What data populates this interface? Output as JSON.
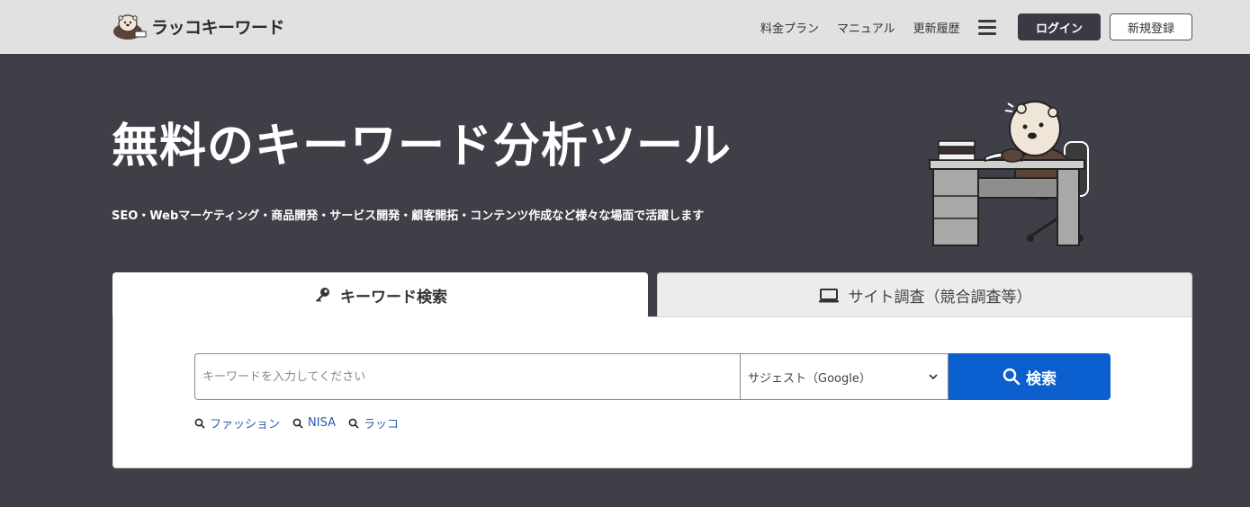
{
  "header": {
    "logo_text": "ラッコキーワード",
    "nav": [
      "料金プラン",
      "マニュアル",
      "更新履歴"
    ],
    "login": "ログイン",
    "signup": "新規登録"
  },
  "hero": {
    "title": "無料のキーワード分析ツール",
    "subtitle": "SEO・Webマーケティング・商品開発・サービス開発・顧客開拓・コンテンツ作成など様々な場面で活躍します"
  },
  "tabs": [
    {
      "label": "キーワード検索",
      "icon": "key-icon"
    },
    {
      "label": "サイト調査（競合調査等）",
      "icon": "laptop-icon"
    }
  ],
  "search": {
    "placeholder": "キーワードを入力してください",
    "select_value": "サジェスト（Google）",
    "button": "検索",
    "suggestions": [
      "ファッション",
      "NISA",
      "ラッコ"
    ]
  },
  "colors": {
    "hero_bg": "#3f3f48",
    "header_bg": "#e1e1e1",
    "accent": "#0c5fcf",
    "link": "#2a5db0"
  }
}
